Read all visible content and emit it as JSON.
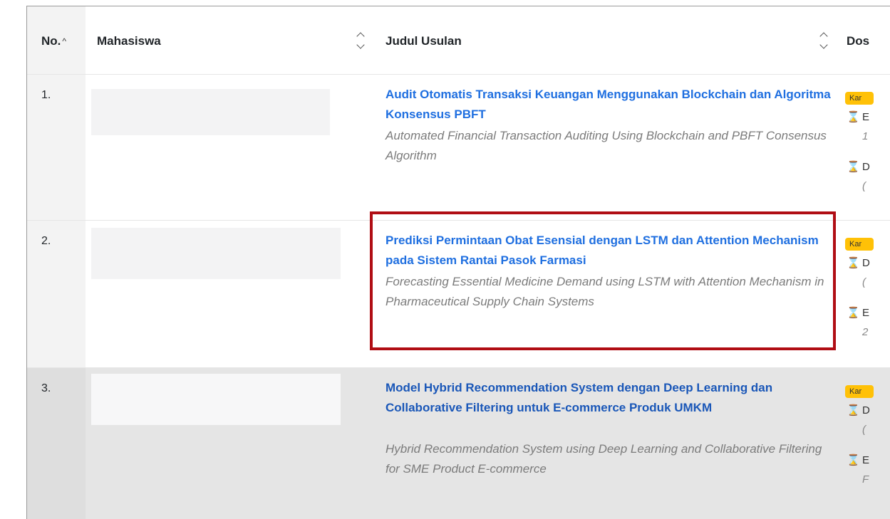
{
  "table": {
    "headers": {
      "no": "No.",
      "no_sort_icon": "^",
      "mahasiswa": "Mahasiswa",
      "judul": "Judul Usulan",
      "dosen": "Dos"
    },
    "rows": [
      {
        "no": "1.",
        "title": "Audit Otomatis Transaksi Keuangan Menggunakan Blockchain dan Algoritma Konsensus PBFT",
        "subtitle": "Automated Financial Transaction Auditing Using Blockchain and PBFT Consensus Algorithm",
        "badge": "Kar",
        "dosen_lines": [
          {
            "icon": "hourglass-icon",
            "text": "E",
            "sub": "1"
          },
          {
            "icon": "hourglass-icon",
            "text": "D",
            "sub": "("
          }
        ]
      },
      {
        "no": "2.",
        "title": "Prediksi Permintaan Obat Esensial dengan LSTM dan Attention Mechanism pada Sistem Rantai Pasok Farmasi",
        "subtitle": "Forecasting Essential Medicine Demand using LSTM with Attention Mechanism in Pharmaceutical Supply Chain Systems",
        "badge": "Kar",
        "dosen_lines": [
          {
            "icon": "hourglass-icon",
            "text": "D",
            "sub": "("
          },
          {
            "icon": "hourglass-icon",
            "text": "E",
            "sub": "2"
          }
        ]
      },
      {
        "no": "3.",
        "title": "Model Hybrid Recommendation System dengan Deep Learning dan Collaborative Filtering untuk E-commerce Produk UMKM",
        "subtitle": "Hybrid Recommendation System using Deep Learning and Collaborative Filtering for SME Product E-commerce",
        "badge": "Kar",
        "dosen_lines": [
          {
            "icon": "hourglass-icon",
            "text": "D",
            "sub": "("
          },
          {
            "icon": "hourglass-icon",
            "text": "E",
            "sub": "F"
          }
        ]
      }
    ]
  },
  "colors": {
    "link": "#1f6fe0",
    "highlight_border": "#b00d14",
    "badge": "#ffc107"
  }
}
